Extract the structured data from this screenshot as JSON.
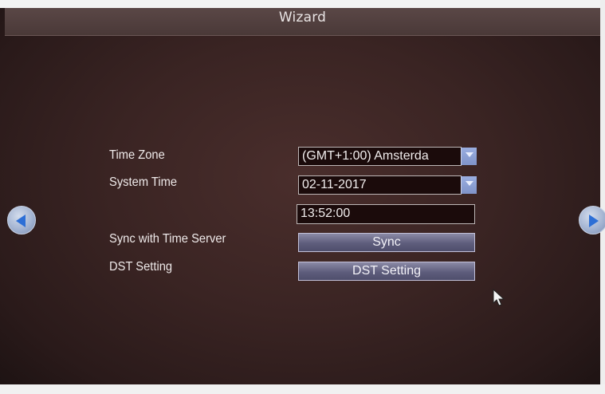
{
  "window": {
    "title": "Wizard"
  },
  "form": {
    "time_zone": {
      "label": "Time Zone",
      "value": "(GMT+1:00) Amsterda"
    },
    "system_time": {
      "label": "System Time",
      "date_value": "02-11-2017",
      "time_value": "13:52:00"
    },
    "sync": {
      "label": "Sync with Time Server",
      "button_label": "Sync"
    },
    "dst": {
      "label": "DST Setting",
      "button_label": "DST Setting"
    }
  },
  "navigation": {
    "prev_icon": "arrow-left-icon",
    "next_icon": "arrow-right-icon"
  },
  "icons": {
    "dropdown": "chevron-down-icon",
    "cursor": "mouse-pointer-icon"
  },
  "colors": {
    "background": "#3a2423",
    "title_bar": "#5a4746",
    "field_bg": "#1b0b0b",
    "button": "#5e5d7c",
    "dropdown_accent": "#8ea2d6",
    "arrow_accent": "#2d6fd6"
  }
}
